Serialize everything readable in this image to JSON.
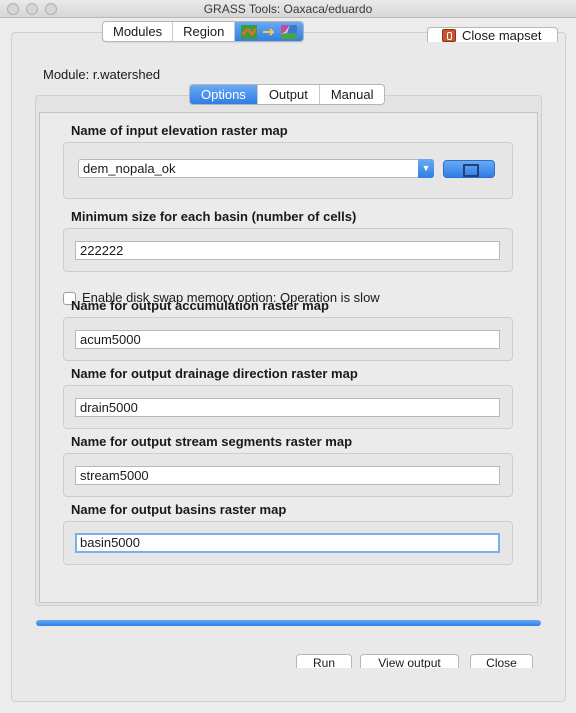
{
  "window": {
    "title": "GRASS Tools: Oaxaca/eduardo"
  },
  "topbar": {
    "tabs": [
      {
        "label": "Modules"
      },
      {
        "label": "Region"
      }
    ],
    "close_mapset_label": "Close mapset"
  },
  "module": {
    "label": "Module: r.watershed"
  },
  "tabs": [
    {
      "label": "Options",
      "active": true
    },
    {
      "label": "Output",
      "active": false
    },
    {
      "label": "Manual",
      "active": false
    }
  ],
  "form": {
    "elevation": {
      "label": "Name of input elevation raster map",
      "value": "dem_nopala_ok"
    },
    "min_size": {
      "label": "Minimum size for each basin (number of cells)",
      "value": "222222"
    },
    "disk_swap": {
      "label": "Enable disk swap memory option: Operation is slow",
      "checked": false
    },
    "accumulation": {
      "label": "Name for output accumulation raster map",
      "value": "acum5000"
    },
    "drainage": {
      "label": "Name for output drainage direction raster map",
      "value": "drain5000"
    },
    "stream": {
      "label": "Name for output stream segments raster map",
      "value": "stream5000"
    },
    "basin": {
      "label": "Name for output basins raster map",
      "value": "basin5000"
    }
  },
  "progress": {
    "value": 1.0
  },
  "buttons": {
    "run": "Run",
    "view_output": "View output",
    "close": "Close"
  },
  "colors": {
    "accent": "#2f7ee6",
    "accent_light": "#6aa9f3"
  },
  "icons": [
    "window-close-icon",
    "window-minimize-icon",
    "window-zoom-icon",
    "raster-map-icon",
    "arrow-right-icon",
    "vector-map-icon",
    "close-mapset-icon",
    "select-map-icon"
  ]
}
